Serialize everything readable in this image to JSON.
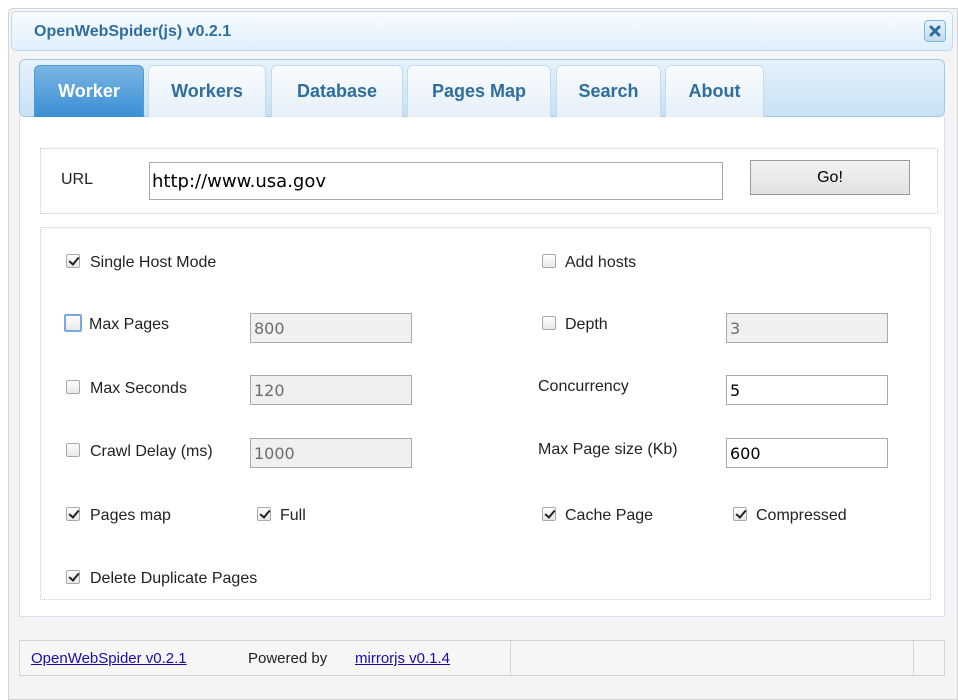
{
  "window": {
    "title": "OpenWebSpider(js) v0.2.1"
  },
  "tabs": [
    {
      "label": "Worker",
      "active": true
    },
    {
      "label": "Workers"
    },
    {
      "label": "Database"
    },
    {
      "label": "Pages Map"
    },
    {
      "label": "Search"
    },
    {
      "label": "About"
    }
  ],
  "url_form": {
    "label": "URL",
    "value": "http://www.usa.gov",
    "go_label": "Go!"
  },
  "options": {
    "single_host_mode": {
      "label": "Single Host Mode",
      "checked": true
    },
    "add_hosts": {
      "label": "Add hosts",
      "checked": false
    },
    "max_pages": {
      "label": "Max Pages",
      "checked": false,
      "value": "800"
    },
    "depth": {
      "label": "Depth",
      "checked": false,
      "value": "3"
    },
    "max_seconds": {
      "label": "Max Seconds",
      "checked": false,
      "value": "120"
    },
    "concurrency": {
      "label": "Concurrency",
      "value": "5"
    },
    "crawl_delay": {
      "label": "Crawl Delay (ms)",
      "checked": false,
      "value": "1000"
    },
    "max_page_size": {
      "label": "Max Page size (Kb)",
      "value": "600"
    },
    "pages_map": {
      "label": "Pages map",
      "checked": true
    },
    "full": {
      "label": "Full",
      "checked": true
    },
    "cache_page": {
      "label": "Cache Page",
      "checked": true
    },
    "compressed": {
      "label": "Compressed",
      "checked": true
    },
    "delete_duplicate_pages": {
      "label": "Delete Duplicate Pages",
      "checked": true
    }
  },
  "status_bar": {
    "app_link": "OpenWebSpider v0.2.1",
    "powered_by": "Powered by",
    "mirror_link": "mirrorjs v0.1.4"
  },
  "icons": {
    "close": "close-icon"
  },
  "colors": {
    "accent": "#3a8fd4",
    "title": "#2e6e9e",
    "link": "#1a0dab"
  }
}
